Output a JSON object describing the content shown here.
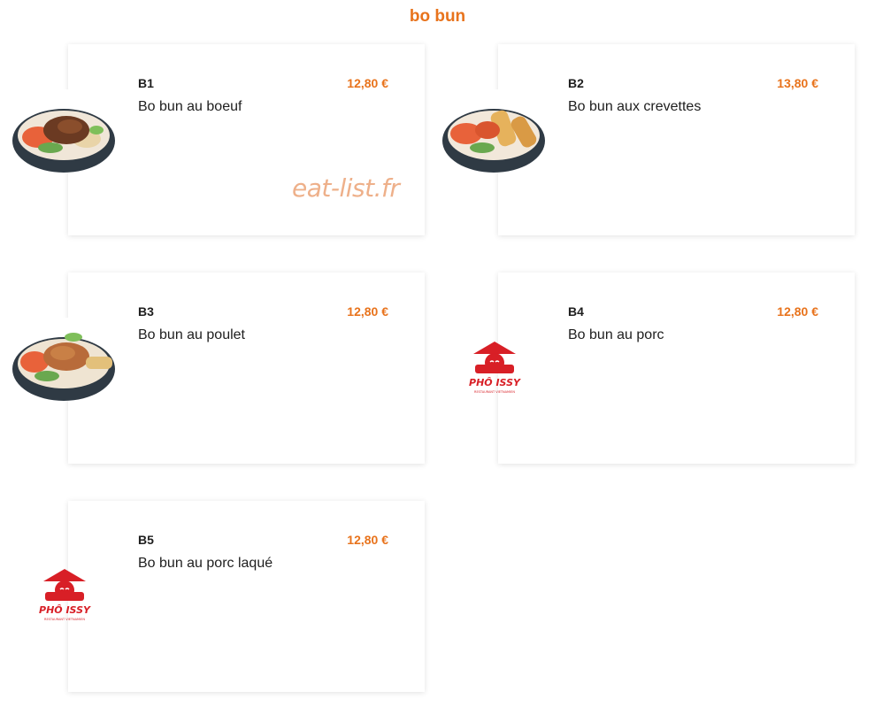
{
  "section": {
    "title": "bo bun"
  },
  "watermark": "eat-list.fr",
  "items": [
    {
      "code": "B1",
      "price": "12,80 €",
      "name": "Bo bun au boeuf",
      "image": "beef-bobun-photo"
    },
    {
      "code": "B2",
      "price": "13,80 €",
      "name": "Bo bun aux crevettes",
      "image": "shrimp-bobun-photo"
    },
    {
      "code": "B3",
      "price": "12,80 €",
      "name": "Bo bun au poulet",
      "image": "chicken-bobun-photo"
    },
    {
      "code": "B4",
      "price": "12,80 €",
      "name": "Bo bun au porc",
      "image": "pho-issy-logo"
    },
    {
      "code": "B5",
      "price": "12,80 €",
      "name": "Bo bun au porc laqué",
      "image": "pho-issy-logo"
    }
  ],
  "logo": {
    "text": "PHÔ ISSY",
    "subtext": "RESTAURANT VIETNAMIEN"
  },
  "colors": {
    "accent": "#e8731c",
    "text": "#1e1e1e",
    "logo_red": "#d81f26",
    "watermark": "#eeb08a"
  }
}
